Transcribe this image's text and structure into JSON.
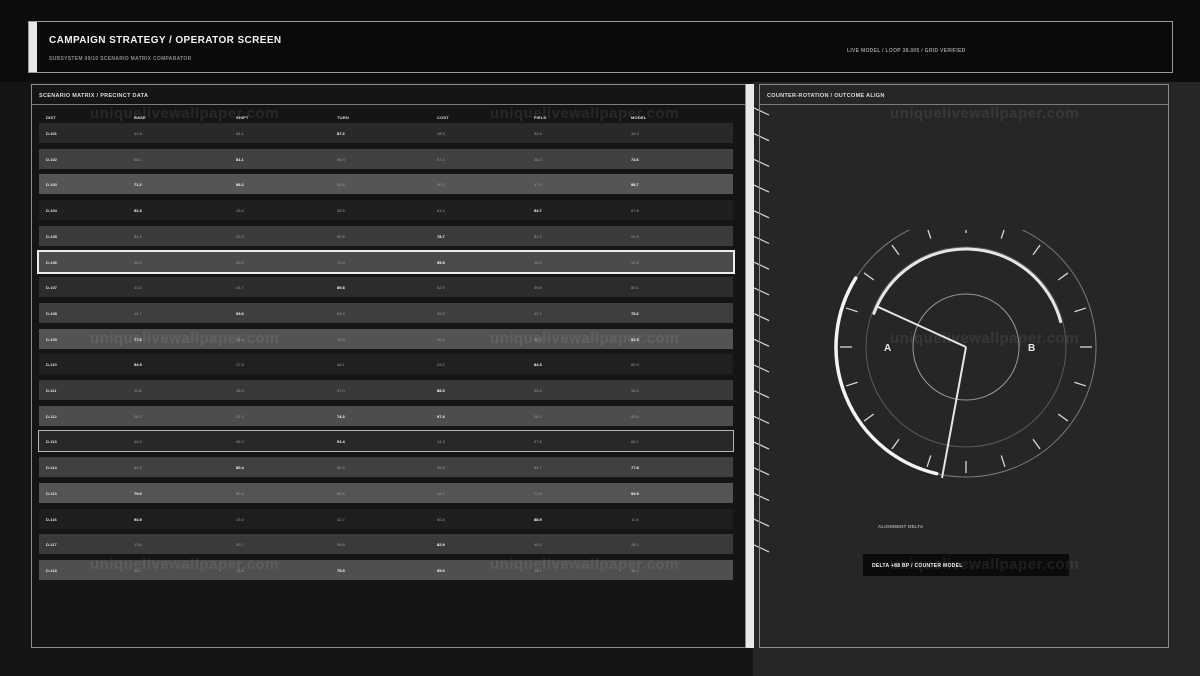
{
  "header": {
    "title": "CAMPAIGN STRATEGY / OPERATOR SCREEN",
    "subtitle": "SUBSYSTEM 09/10  SCENARIO MATRIX COMPARATOR",
    "status": "LIVE MODEL / LOOP 38.005 / GRID VERIFIED"
  },
  "matrix": {
    "title": "SCENARIO MATRIX / PRECINCT DATA",
    "columns": [
      "DIST",
      "BASE",
      "SHIFT",
      "TURN",
      "COST",
      "FIELD",
      "MODEL"
    ],
    "rows": [
      {
        "cells": [
          "D-101",
          "41.8",
          "44.1",
          "87.2",
          "18.3",
          "33.4",
          "34.3"
        ],
        "hi": [
          3
        ],
        "shade": "#292a28"
      },
      {
        "cells": [
          "D-102",
          "58.1",
          "81.1",
          "94.3",
          "57.4",
          "28.3",
          "73.6"
        ],
        "hi": [
          2,
          6
        ],
        "shade": "#404140"
      },
      {
        "cells": [
          "D-103",
          "71.2",
          "98.2",
          "20.4",
          "90.3",
          "47.6",
          "98.7"
        ],
        "hi": [
          1,
          2,
          6
        ],
        "shade": "#555654"
      },
      {
        "cells": [
          "D-104",
          "92.3",
          "15.4",
          "28.5",
          "61.4",
          "94.7",
          "87.8"
        ],
        "hi": [
          1,
          5
        ],
        "shade": "#1e1f1e"
      },
      {
        "cells": [
          "D-105",
          "84.3",
          "22.5",
          "50.6",
          "78.7",
          "81.0",
          "24.9"
        ],
        "hi": [
          4
        ],
        "shade": "#3a3b3a"
      },
      {
        "cells": [
          "D-106",
          "26.0",
          "49.6",
          "72.3",
          "95.5",
          "18.0",
          "32.8"
        ],
        "hi": [
          4
        ],
        "shade": "#4a4b4a",
        "state": "selected"
      },
      {
        "cells": [
          "D-107",
          "43.6",
          "44.7",
          "89.8",
          "52.9",
          "39.8",
          "80.1"
        ],
        "hi": [
          3
        ],
        "shade": "#2b2c2b"
      },
      {
        "cells": [
          "D-108",
          "14.7",
          "93.6",
          "64.5",
          "29.8",
          "42.1",
          "75.2"
        ],
        "hi": [
          2,
          6
        ],
        "shade": "#3d3e3d"
      },
      {
        "cells": [
          "D-109",
          "77.6",
          "64.6",
          "13.8",
          "90.2",
          "18.2",
          "92.5"
        ],
        "hi": [
          1,
          6
        ],
        "shade": "#525352"
      },
      {
        "cells": [
          "D-110",
          "94.9",
          "17.8",
          "48.1",
          "43.2",
          "84.3",
          "89.4"
        ],
        "hi": [
          1,
          5
        ],
        "shade": "#1f201f"
      },
      {
        "cells": [
          "D-111",
          "11.8",
          "18.5",
          "37.0",
          "88.3",
          "35.4",
          "34.5"
        ],
        "hi": [
          4
        ],
        "shade": "#383938"
      },
      {
        "cells": [
          "D-112",
          "28.2",
          "31.2",
          "74.3",
          "97.4",
          "28.1",
          "43.6"
        ],
        "hi": [
          3,
          4
        ],
        "shade": "#4c4d4c"
      },
      {
        "cells": [
          "D-113",
          "49.2",
          "46.3",
          "91.4",
          "14.3",
          "37.6",
          "68.7"
        ],
        "hi": [
          3
        ],
        "shade": "#272827",
        "state": "outlined"
      },
      {
        "cells": [
          "D-114",
          "64.3",
          "80.4",
          "89.5",
          "35.6",
          "54.7",
          "77.8"
        ],
        "hi": [
          2,
          6
        ],
        "shade": "#3f403f"
      },
      {
        "cells": [
          "D-115",
          "79.6",
          "80.5",
          "59.6",
          "48.7",
          "71.8",
          "94.9"
        ],
        "hi": [
          1,
          6
        ],
        "shade": "#535453"
      },
      {
        "cells": [
          "D-116",
          "94.5",
          "19.4",
          "42.7",
          "60.8",
          "88.9",
          "11.8"
        ],
        "hi": [
          1,
          5
        ],
        "shade": "#1d1e1d"
      },
      {
        "cells": [
          "D-117",
          "13.6",
          "30.7",
          "59.8",
          "82.9",
          "40.0",
          "28.1"
        ],
        "hi": [
          4
        ],
        "shade": "#393a39"
      },
      {
        "cells": [
          "D-118",
          "38.7",
          "13.8",
          "75.9",
          "99.0",
          "18.1",
          "34.2"
        ],
        "hi": [
          3,
          4
        ],
        "shade": "#4e4f4e"
      }
    ]
  },
  "outcome": {
    "title": "COUNTER-ROTATION / OUTCOME ALIGN",
    "marker_a": "A",
    "marker_b": "B",
    "alignment_label": "ALIGNMENT DELTA",
    "delta_text": "DELTA +88 BP / COUNTER MODEL"
  },
  "watermark": "uniquelivewallpaper.com",
  "colors": {
    "background": "#0c0c0c",
    "panel_left": "#141514",
    "panel_right": "#262725",
    "accent": "#e6e6e6",
    "border": "#8c8c8c"
  }
}
